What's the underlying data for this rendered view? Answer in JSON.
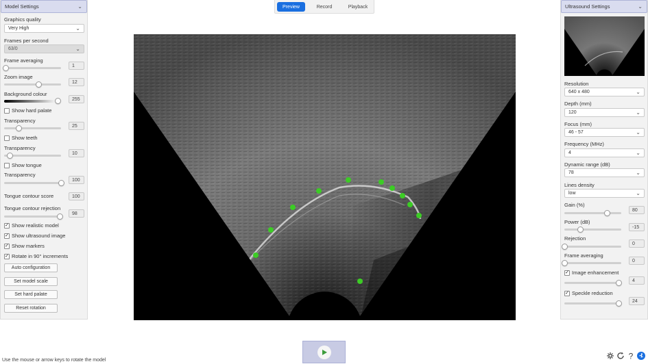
{
  "tabs": [
    {
      "label": "Preview",
      "active": true
    },
    {
      "label": "Record",
      "active": false
    },
    {
      "label": "Playback",
      "active": false
    }
  ],
  "left_panel": {
    "title": "Model Settings",
    "graphics_quality": {
      "label": "Graphics quality",
      "value": "Very High"
    },
    "fps": {
      "label": "Frames per second",
      "value": "63/0"
    },
    "frame_averaging": {
      "label": "Frame averaging",
      "value": "1",
      "level": 0.02
    },
    "zoom_image": {
      "label": "Zoom image",
      "value": "12",
      "level": 0.6
    },
    "background_colour": {
      "label": "Background colour",
      "value": "255",
      "level": 1.0
    },
    "show_hard_palate": {
      "label": "Show hard palate",
      "checked": false
    },
    "transparency_1": {
      "label": "Transparency",
      "value": "25",
      "level": 0.25
    },
    "show_teeth": {
      "label": "Show teeth",
      "checked": false
    },
    "transparency_2": {
      "label": "Transparency",
      "value": "10",
      "level": 0.1
    },
    "show_tongue": {
      "label": "Show tongue",
      "checked": false
    },
    "transparency_3": {
      "label": "Transparency",
      "value": "100",
      "level": 1.0
    },
    "tongue_contour_score": {
      "label": "Tongue contour score",
      "value": "100"
    },
    "tongue_contour_rejection": {
      "label": "Tongue contour rejection",
      "value": "98",
      "level": 0.98
    },
    "show_realistic_model": {
      "label": "Show realistic model",
      "checked": true
    },
    "show_ultrasound_image": {
      "label": "Show ultrasound image",
      "checked": true
    },
    "show_markers": {
      "label": "Show markers",
      "checked": true
    },
    "rotate_90": {
      "label": "Rotate in 90° increments",
      "checked": true
    },
    "buttons": {
      "auto_configuration": "Auto configuration",
      "set_model_scale": "Set model scale",
      "set_hard_palate": "Set hard palate",
      "reset_rotation": "Reset rotation"
    }
  },
  "right_panel": {
    "title": "Ultrasound Settings",
    "resolution": {
      "label": "Resolution",
      "value": "640 x 480"
    },
    "depth": {
      "label": "Depth (mm)",
      "value": "120"
    },
    "focus": {
      "label": "Focus (mm)",
      "value": "46 - 57"
    },
    "frequency": {
      "label": "Frequency (MHz)",
      "value": "4"
    },
    "dynamic_range": {
      "label": "Dynamic range (dB)",
      "value": "78"
    },
    "lines_density": {
      "label": "Lines density",
      "value": "low"
    },
    "gain": {
      "label": "Gain (%)",
      "value": "80",
      "level": 0.75
    },
    "power": {
      "label": "Power (dB)",
      "value": "-15",
      "level": 0.28
    },
    "rejection": {
      "label": "Rejection",
      "value": "0",
      "level": 0.0
    },
    "frame_averaging": {
      "label": "Frame averaging",
      "value": "0",
      "level": 0.0
    },
    "image_enhancement": {
      "label": "Image enhancement",
      "checked": true,
      "value": "4",
      "level": 0.95
    },
    "speckle_reduction": {
      "label": "Speckle reduction",
      "checked": true,
      "value": "24",
      "level": 0.95
    }
  },
  "footer": {
    "hint": "Use the mouse or arrow keys to rotate the model"
  },
  "icons": {
    "play": "play-icon",
    "corner": [
      "settings-icon",
      "refresh-icon",
      "help-icon",
      "accessibility-icon"
    ]
  },
  "colors": {
    "accent": "#1a6fe0",
    "panel_header": "#d9dcef",
    "marker_green": "#3ccc25"
  }
}
